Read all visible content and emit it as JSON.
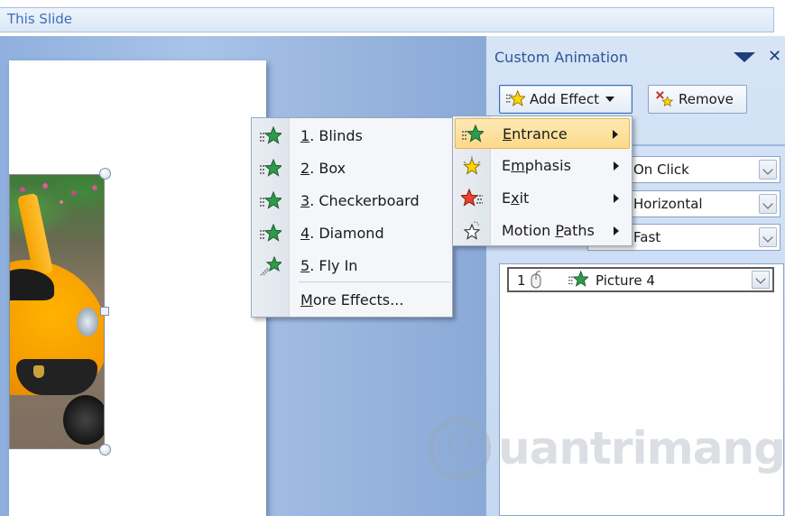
{
  "top_bar": {
    "text": "This Slide"
  },
  "pane": {
    "title": "Custom Animation",
    "add_effect_label": "Add Effect",
    "remove_label": "Remove",
    "start_value": "On Click",
    "property_value": "Horizontal",
    "speed_value": "Fast",
    "list_items": [
      {
        "order": "1",
        "name": "Picture 4"
      }
    ]
  },
  "effect_menu": {
    "items": [
      {
        "key": "1",
        "text": ". Blinds",
        "icon": "green-star-icon"
      },
      {
        "key": "2",
        "text": ". Box",
        "icon": "green-star-icon"
      },
      {
        "key": "3",
        "text": ". Checkerboard",
        "icon": "green-star-icon"
      },
      {
        "key": "4",
        "text": ". Diamond",
        "icon": "green-star-icon"
      },
      {
        "key": "5",
        "text": ". Fly In",
        "icon": "green-star-fly-icon"
      }
    ],
    "more": {
      "key": "M",
      "text": "ore Effects..."
    }
  },
  "add_effect_menu": {
    "items": [
      {
        "key": "E",
        "text": "ntrance",
        "icon": "entrance-star-icon",
        "highlighted": true
      },
      {
        "pre": "E",
        "key": "m",
        "text": "phasis",
        "icon": "emphasis-star-icon"
      },
      {
        "pre": "E",
        "key": "x",
        "text": "it",
        "icon": "exit-star-icon"
      },
      {
        "pre": "Motion ",
        "key": "P",
        "text": "aths",
        "icon": "motion-path-star-icon"
      }
    ]
  },
  "watermark": {
    "text": "uantrimang"
  },
  "colors": {
    "accent": "#2f5597",
    "highlight": "#fdd98a",
    "workspace": "#9bb8e2"
  }
}
